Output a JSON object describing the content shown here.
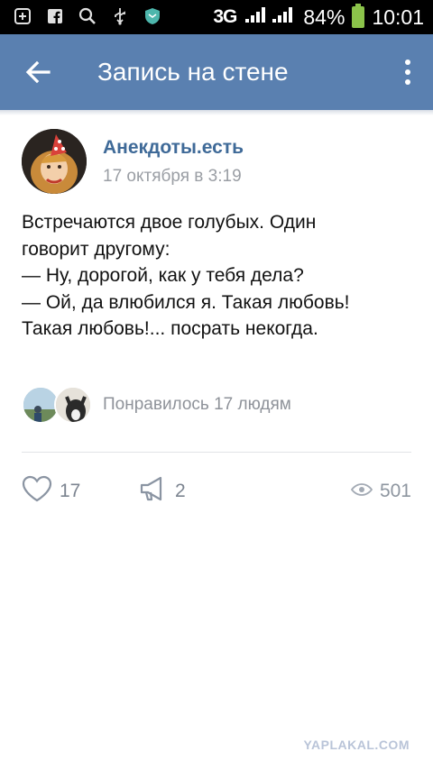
{
  "status_bar": {
    "network": "3G",
    "battery": "84%",
    "time": "10:01",
    "icons": [
      "add-box-icon",
      "facebook-icon",
      "search-icon",
      "usb-icon",
      "shield-icon"
    ]
  },
  "toolbar": {
    "title": "Запись на стене",
    "back_icon": "arrow-back-icon",
    "menu_icon": "more-vert-icon"
  },
  "post": {
    "author": "Анекдоты.есть",
    "date": "17 октября в 3:19",
    "lines": [
      "Встречаются двое голубых. Один",
      "говорит другому:",
      "— Ну, дорогой, как у тебя дела?",
      "— Ой, да влюбился я. Такая любовь!",
      "Такая любовь!... посрать некогда."
    ],
    "liked_by": "Понравилось 17 людям"
  },
  "actions": {
    "likes": "17",
    "shares": "2",
    "views": "501"
  },
  "watermark": "YAPLAKAL.COM",
  "colors": {
    "toolbar": "#5a80b0",
    "author": "#3f6a98",
    "battery": "#8bc34a"
  }
}
